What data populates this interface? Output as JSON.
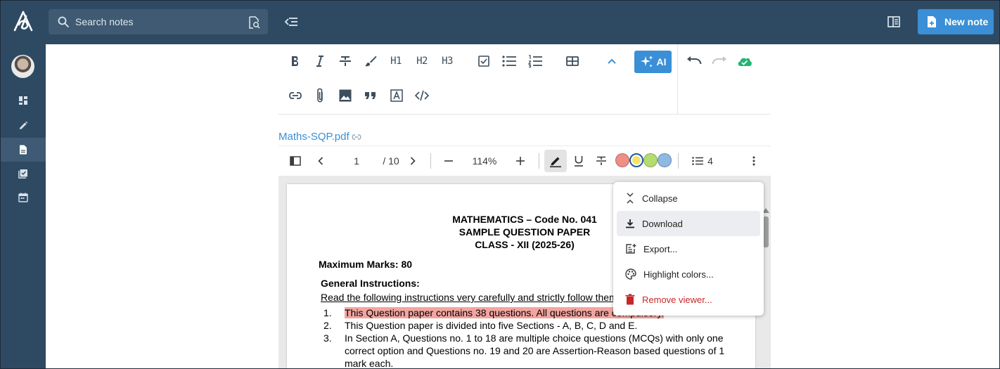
{
  "search": {
    "placeholder": "Search notes"
  },
  "header": {
    "new_note_label": "New note"
  },
  "editor": {
    "headings": [
      "H1",
      "H2",
      "H3"
    ],
    "ai_label": "AI"
  },
  "attachment": {
    "title": "Maths-SQP.pdf"
  },
  "viewer": {
    "page_current": "1",
    "page_total": "/ 10",
    "zoom": "114%",
    "highlight_count": "4",
    "swatch_colors": [
      "#ee8e87",
      "#f6e36a",
      "#b5dc6f",
      "#8eb9e2"
    ],
    "selected_swatch": 1
  },
  "pdf": {
    "title_line1": "MATHEMATICS – Code No. 041",
    "title_line2": "SAMPLE QUESTION PAPER",
    "title_line3": "CLASS - XII (2025-26)",
    "max_marks": "Maximum Marks: 80",
    "gi_heading": "General Instructions:",
    "gi_intro": "Read the following instructions very carefully and strictly follow them:",
    "items": [
      {
        "num": "1.",
        "text": "This Question paper contains 38 questions. All questions are compulsory."
      },
      {
        "num": "2.",
        "text": "This Question paper is divided into five Sections - A, B, C, D and E."
      },
      {
        "num": "3.",
        "text_line1": "In Section A, Questions no. 1 to 18 are multiple choice questions (MCQs) with only one",
        "text_line2": "correct option and Questions no. 19 and 20 are Assertion-Reason based questions of 1",
        "text_line3": "mark each."
      }
    ]
  },
  "menu": {
    "items": [
      {
        "label": "Collapse",
        "icon": "collapse-icon"
      },
      {
        "label": "Download",
        "icon": "download-icon"
      },
      {
        "label": "Export...",
        "icon": "export-icon"
      },
      {
        "label": "Highlight colors...",
        "icon": "palette-icon"
      },
      {
        "label": "Remove viewer...",
        "icon": "trash-icon"
      }
    ]
  },
  "colors": {
    "topbar": "#2e4a63",
    "accent": "#3a8fd6",
    "danger": "#c62828",
    "highlight": "#f2a5a0"
  }
}
